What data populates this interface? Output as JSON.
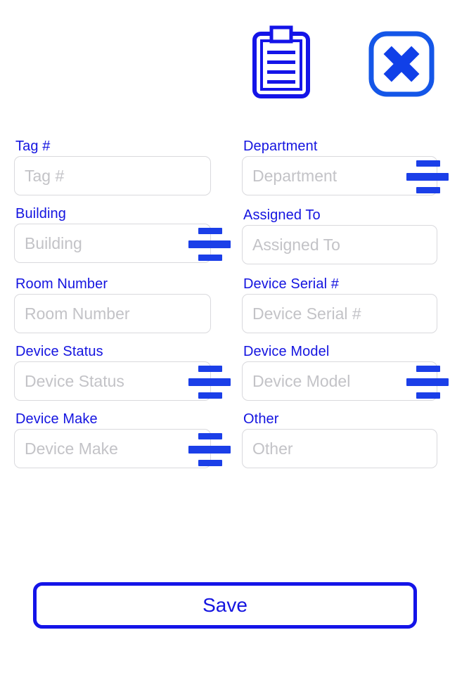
{
  "app": {
    "background_color": "#ffffff",
    "accent_color": "#1414e8",
    "label_color": "#1414e0",
    "placeholder_color": "#c3c3c7",
    "field_border_color": "#d9d9dd"
  },
  "header": {
    "clipboard_icon": "clipboard-icon",
    "clipboard_line_count": 4,
    "close_icon": "close-x-icon"
  },
  "form": {
    "fields": [
      {
        "label": "Tag #",
        "placeholder": "Tag #",
        "value": "",
        "column": "left",
        "row": 1,
        "has_picker_icon": false,
        "picker_icon": "sliders-icon"
      },
      {
        "label": "Department",
        "placeholder": "Department",
        "value": "",
        "column": "right",
        "row": 1,
        "has_picker_icon": true,
        "picker_icon": "sliders-icon"
      },
      {
        "label": "Building",
        "placeholder": "Building",
        "value": "",
        "column": "left",
        "row": 2,
        "has_picker_icon": true,
        "picker_icon": "sliders-icon"
      },
      {
        "label": "Assigned To",
        "placeholder": "Assigned To",
        "value": "",
        "column": "right",
        "row": 2,
        "has_picker_icon": false,
        "picker_icon": "sliders-icon"
      },
      {
        "label": "Room Number",
        "placeholder": "Room Number",
        "value": "",
        "column": "left",
        "row": 3,
        "has_picker_icon": false,
        "picker_icon": "sliders-icon"
      },
      {
        "label": "Device Serial #",
        "placeholder": "Device Serial #",
        "value": "",
        "column": "right",
        "row": 3,
        "has_picker_icon": false,
        "picker_icon": "sliders-icon"
      },
      {
        "label": "Device Status",
        "placeholder": "Device Status",
        "value": "",
        "column": "left",
        "row": 4,
        "has_picker_icon": true,
        "picker_icon": "sliders-icon"
      },
      {
        "label": "Device Model",
        "placeholder": "Device Model",
        "value": "",
        "column": "right",
        "row": 4,
        "has_picker_icon": true,
        "picker_icon": "sliders-icon"
      },
      {
        "label": "Device Make",
        "placeholder": "Device Make",
        "value": "",
        "column": "left",
        "row": 5,
        "has_picker_icon": true,
        "picker_icon": "sliders-icon"
      },
      {
        "label": "Other",
        "placeholder": "Other",
        "value": "",
        "column": "right",
        "row": 5,
        "has_picker_icon": false,
        "picker_icon": "sliders-icon"
      }
    ]
  },
  "footer": {
    "save_label": "Save"
  }
}
